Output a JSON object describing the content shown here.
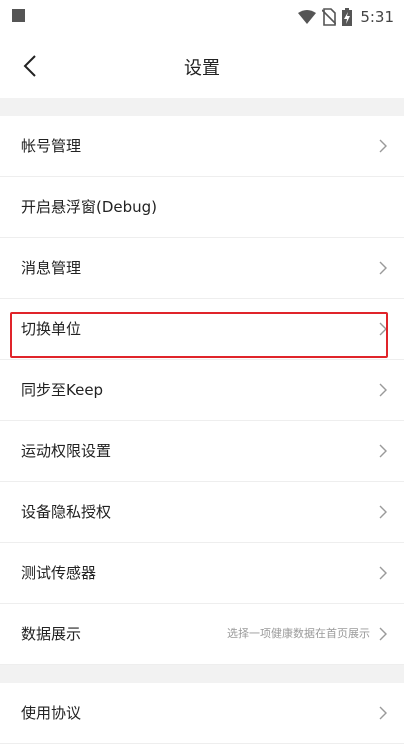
{
  "status_bar": {
    "time": "5:31",
    "icons": [
      "notification-square-icon",
      "wifi-icon",
      "no-sim-icon",
      "battery-charging-icon"
    ]
  },
  "header": {
    "title": "设置",
    "back_icon": "back-arrow-icon"
  },
  "settings": {
    "items": [
      {
        "label": "帐号管理",
        "chevron": true
      },
      {
        "label": "开启悬浮窗(Debug)",
        "chevron": false
      },
      {
        "label": "消息管理",
        "chevron": true
      },
      {
        "label": "切换单位",
        "chevron": true,
        "highlighted": true
      },
      {
        "label": "同步至Keep",
        "chevron": true
      },
      {
        "label": "运动权限设置",
        "chevron": true
      },
      {
        "label": "设备隐私授权",
        "chevron": true
      },
      {
        "label": "测试传感器",
        "chevron": true
      },
      {
        "label": "数据展示",
        "chevron": true,
        "hint": "选择一项健康数据在首页展示"
      }
    ],
    "items2": [
      {
        "label": "使用协议",
        "chevron": true
      }
    ]
  },
  "colors": {
    "highlight_border": "#e0242a",
    "section_gap": "#f2f2f2"
  }
}
